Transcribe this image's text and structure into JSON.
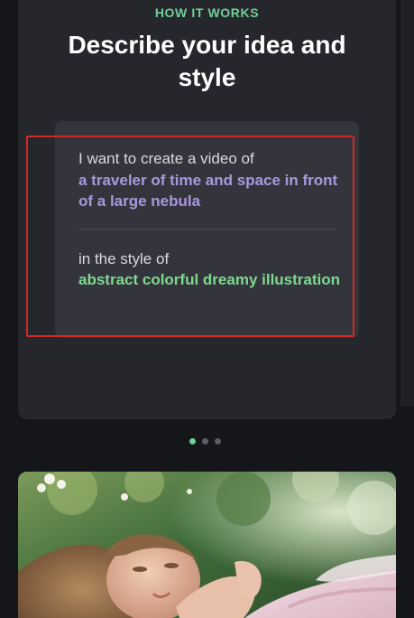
{
  "how_it_works": {
    "eyebrow": "HOW IT WORKS",
    "title": "Describe your idea and style",
    "prompt": {
      "intro": "I want to create a video of",
      "idea": "a traveler of time and space in front of a large nebula",
      "style_intro": "in the style of",
      "style": "abstract colorful dreamy illustration"
    },
    "carousel": {
      "page_count": 3,
      "active_index": 0
    }
  },
  "example_image": {
    "icon": "painted-portrait-image"
  },
  "colors": {
    "background": "#151619",
    "card": "#26272c",
    "prompt_box": "#34353c",
    "accent_green": "#6fcf97",
    "idea_purple": "#a998dd",
    "style_green": "#7ed98f",
    "highlight_red": "#d3282a"
  }
}
